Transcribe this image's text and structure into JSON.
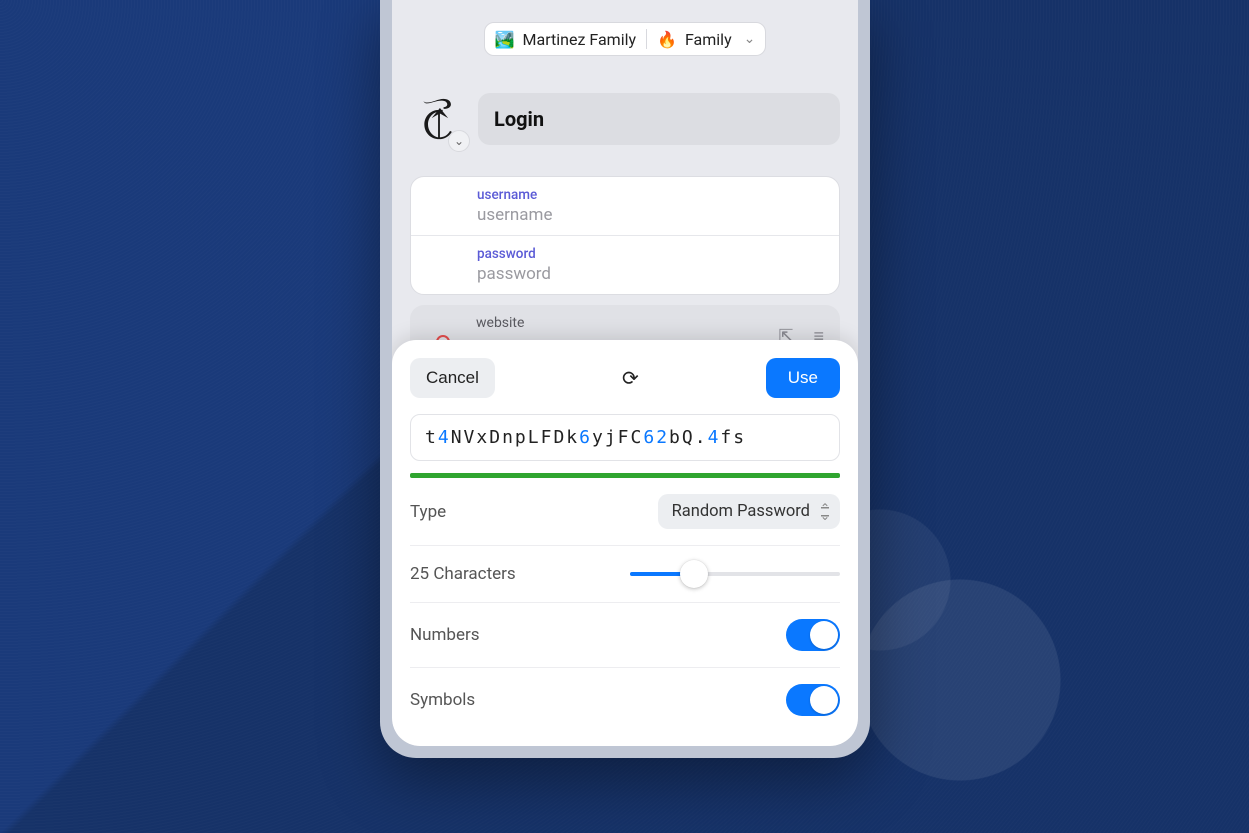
{
  "vaults": {
    "primary_emoji": "🏞️",
    "primary_label": "Martinez Family",
    "secondary_emoji": "🔥",
    "secondary_label": "Family"
  },
  "item": {
    "title": "Login"
  },
  "fields": {
    "username": {
      "label": "username",
      "value": "username"
    },
    "password": {
      "label": "password",
      "value": "password"
    },
    "website": {
      "label": "website"
    }
  },
  "generator": {
    "cancel": "Cancel",
    "use": "Use",
    "password_chars": [
      {
        "c": "t",
        "t": "let"
      },
      {
        "c": "4",
        "t": "num"
      },
      {
        "c": "N",
        "t": "let"
      },
      {
        "c": "V",
        "t": "let"
      },
      {
        "c": "x",
        "t": "let"
      },
      {
        "c": "D",
        "t": "let"
      },
      {
        "c": "n",
        "t": "let"
      },
      {
        "c": "p",
        "t": "let"
      },
      {
        "c": "L",
        "t": "let"
      },
      {
        "c": "F",
        "t": "let"
      },
      {
        "c": "D",
        "t": "let"
      },
      {
        "c": "k",
        "t": "let"
      },
      {
        "c": "6",
        "t": "num"
      },
      {
        "c": "y",
        "t": "let"
      },
      {
        "c": "j",
        "t": "let"
      },
      {
        "c": "F",
        "t": "let"
      },
      {
        "c": "C",
        "t": "let"
      },
      {
        "c": "6",
        "t": "num"
      },
      {
        "c": "2",
        "t": "num"
      },
      {
        "c": "b",
        "t": "let"
      },
      {
        "c": "Q",
        "t": "let"
      },
      {
        "c": ".",
        "t": "sym"
      },
      {
        "c": "4",
        "t": "num"
      },
      {
        "c": "f",
        "t": "let"
      },
      {
        "c": "s",
        "t": "let"
      }
    ],
    "type_label": "Type",
    "type_value": "Random Password",
    "length_label": "25 Characters",
    "length_value": 25,
    "length_min": 8,
    "length_max": 64,
    "numbers_label": "Numbers",
    "numbers_on": true,
    "symbols_label": "Symbols",
    "symbols_on": true
  }
}
